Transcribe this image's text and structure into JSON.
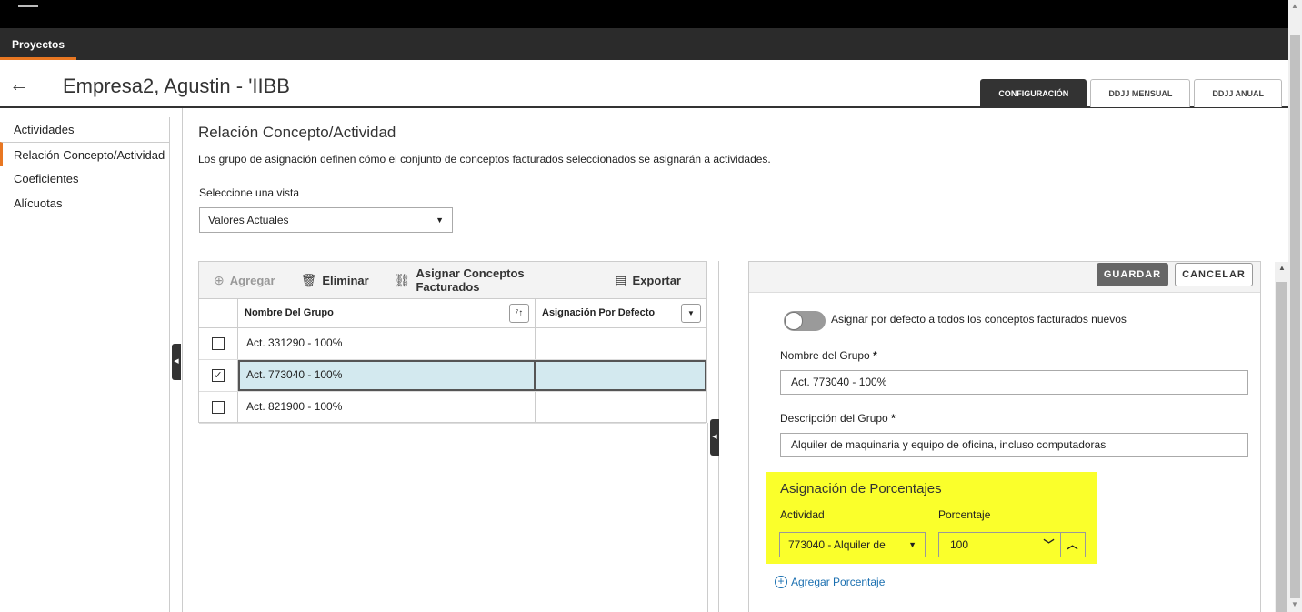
{
  "nav": {
    "projects_tab": "Proyectos"
  },
  "header": {
    "back_icon": "←",
    "title": "Empresa2, Agustin - 'IIBB",
    "tabs": [
      {
        "label": "CONFIGURACIÓN",
        "active": true
      },
      {
        "label": "DDJJ MENSUAL",
        "active": false
      },
      {
        "label": "DDJJ ANUAL",
        "active": false
      }
    ]
  },
  "sidebar": {
    "items": [
      {
        "label": "Actividades",
        "active": false
      },
      {
        "label": "Relación Concepto/Actividad",
        "active": true
      },
      {
        "label": "Coeficientes",
        "active": false
      },
      {
        "label": "Alícuotas",
        "active": false
      }
    ]
  },
  "main": {
    "title": "Relación Concepto/Actividad",
    "description": "Los grupo de asignación definen cómo el conjunto de conceptos facturados seleccionados se asignarán a actividades.",
    "view_label": "Seleccione una vista",
    "view_value": "Valores Actuales"
  },
  "grid": {
    "toolbar": {
      "add": "Agregar",
      "delete": "Eliminar",
      "assign": "Asignar Conceptos Facturados",
      "export": "Exportar"
    },
    "columns": [
      "Nombre Del Grupo",
      "Asignación Por Defecto"
    ],
    "rows": [
      {
        "name": "Act. 331290 - 100%",
        "default": "",
        "checked": false
      },
      {
        "name": "Act. 773040 - 100%",
        "default": "",
        "checked": true
      },
      {
        "name": "Act. 821900 - 100%",
        "default": "",
        "checked": false
      }
    ]
  },
  "detail": {
    "save": "GUARDAR",
    "cancel": "CANCELAR",
    "toggle_label": "Asignar por defecto a todos los conceptos facturados nuevos",
    "toggle_on": false,
    "group_name_label": "Nombre del Grupo",
    "group_name_value": "Act. 773040 - 100%",
    "group_desc_label": "Descripción del Grupo",
    "group_desc_value": "Alquiler de maquinaria y equipo de oficina, incluso computadoras",
    "required_mark": "*",
    "pct_title": "Asignación de Porcentajes",
    "activity_label": "Actividad",
    "percent_label": "Porcentaje",
    "activity_value": "773040 - Alquiler de",
    "percent_value": "100",
    "add_pct": "Agregar Porcentaje"
  },
  "colors": {
    "accent": "#e87722",
    "highlight": "#faff2b",
    "selected_row": "#d3e9ef",
    "link": "#1a6fb0"
  }
}
